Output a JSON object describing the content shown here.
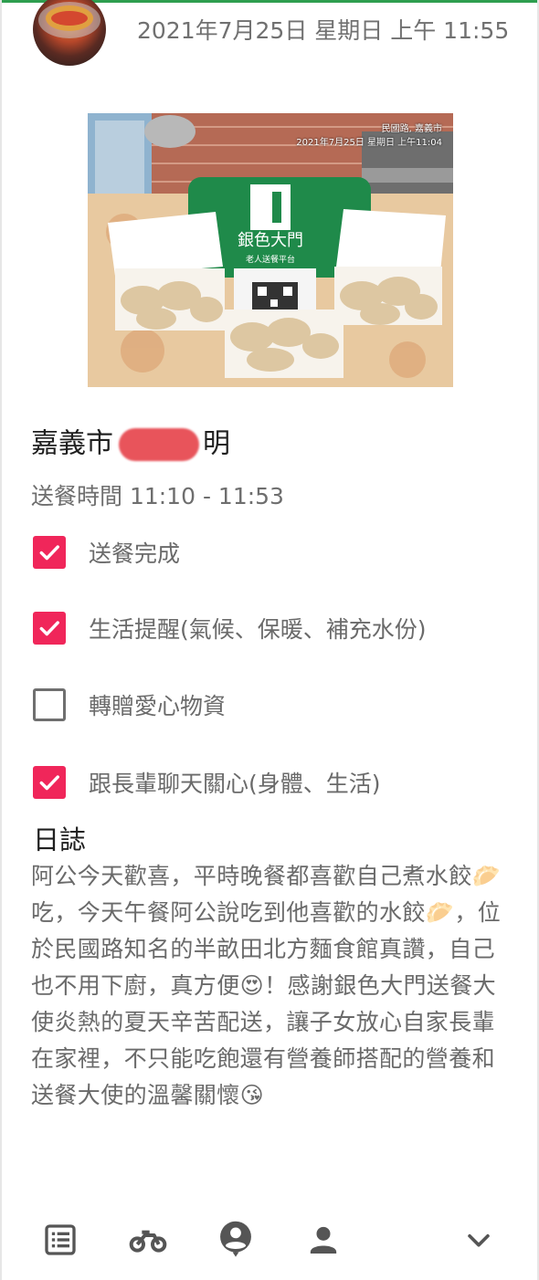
{
  "post": {
    "time": "2021年7月25日 星期日 上午 11:55"
  },
  "photo": {
    "caption_line1": "民國路, 嘉義市",
    "caption_line2": "2021年7月25日 星期日 上午11:04",
    "bag_text": "銀色大門",
    "bag_subtext": "老人送餐平台"
  },
  "recipient": {
    "city": "嘉義市",
    "name_suffix": "明"
  },
  "delivery": {
    "time_text": "送餐時間 11:10 - 11:53"
  },
  "checklist": [
    {
      "label": "送餐完成",
      "checked": true
    },
    {
      "label": "生活提醒(氣候、保暖、補充水份)",
      "checked": true
    },
    {
      "label": "轉贈愛心物資",
      "checked": false
    },
    {
      "label": "跟長輩聊天關心(身體、生活)",
      "checked": true
    }
  ],
  "log": {
    "title": "日誌",
    "body": "阿公今天歡喜，平時晚餐都喜歡自己煮水餃🥟吃，今天午餐阿公說吃到他喜歡的水餃🥟，位於民國路知名的半畝田北方麵食館真讚，自己也不用下廚，真方便😍！感謝銀色大門送餐大使炎熱的夏天辛苦配送，讓子女放心自家長輩在家裡，不只能吃飽還有營養師搭配的營養和送餐大使的溫馨關懷😘"
  },
  "nav": {
    "items": [
      "list-icon",
      "bike-icon",
      "account-circle-icon",
      "person-icon",
      "chevron-down-icon"
    ]
  },
  "colors": {
    "accent": "#f0265a",
    "top_bar": "#2e9e4f",
    "text_muted": "#6a6a6a"
  }
}
